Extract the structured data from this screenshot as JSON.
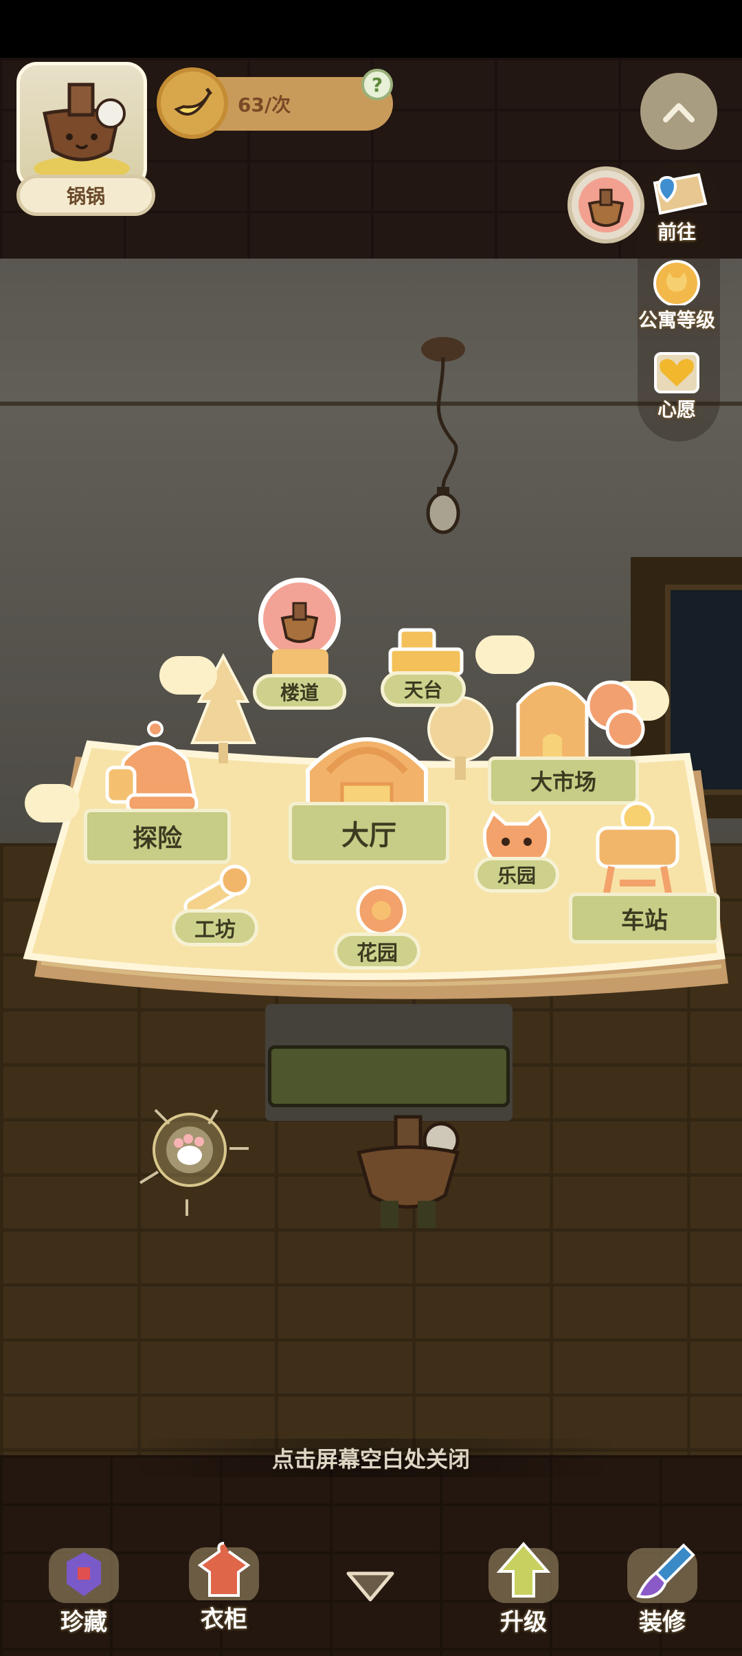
{
  "player": {
    "name": "锅锅"
  },
  "currency": {
    "rate": "63/次",
    "help_glyph": "?",
    "icon": "banana-icon"
  },
  "side_menu": {
    "items": [
      {
        "label": "前往",
        "icon": "map-pin-icon"
      },
      {
        "label": "公寓等级",
        "icon": "cat-medal-icon"
      },
      {
        "label": "心愿",
        "icon": "heart-icon"
      }
    ]
  },
  "map": {
    "locations": [
      {
        "id": "stairway",
        "label": "楼道"
      },
      {
        "id": "rooftop",
        "label": "天台"
      },
      {
        "id": "market",
        "label": "大市场"
      },
      {
        "id": "explore",
        "label": "探险"
      },
      {
        "id": "lobby",
        "label": "大厅"
      },
      {
        "id": "park",
        "label": "乐园"
      },
      {
        "id": "workshop",
        "label": "工坊"
      },
      {
        "id": "garden",
        "label": "花园"
      },
      {
        "id": "station",
        "label": "车站"
      }
    ]
  },
  "close_hint": "点击屏幕空白处关闭",
  "bottom_nav": {
    "items": [
      {
        "label": "珍藏",
        "icon": "treasure-icon"
      },
      {
        "label": "衣柜",
        "icon": "wardrobe-icon"
      },
      {
        "label": "",
        "icon": "chevron-down-icon"
      },
      {
        "label": "升级",
        "icon": "upgrade-arrow-icon"
      },
      {
        "label": "装修",
        "icon": "paintbrush-icon"
      }
    ]
  },
  "colors": {
    "map_paper": "#f6dfa3",
    "banner_green": "#c7cc86",
    "accent_gold": "#d8a74c"
  }
}
